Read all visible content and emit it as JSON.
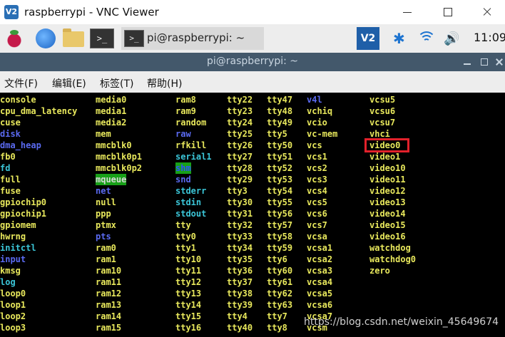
{
  "window": {
    "title": "raspberrypi - VNC Viewer",
    "logo_text": "V2"
  },
  "panel": {
    "terminal_icon_text": ">_",
    "task_label": "pi@raspberrypi: ~",
    "vnc_tray_text": "V2",
    "clock": "11:09"
  },
  "terminal": {
    "title": "pi@raspberrypi: ~",
    "menu": [
      "文件(F)",
      "编辑(E)",
      "标签(T)",
      "帮助(H)"
    ]
  },
  "columns": [
    [
      {
        "t": "console",
        "c": "y"
      },
      {
        "t": "cpu_dma_latency",
        "c": "y"
      },
      {
        "t": "cuse",
        "c": "y"
      },
      {
        "t": "disk",
        "c": "b"
      },
      {
        "t": "dma_heap",
        "c": "b"
      },
      {
        "t": "fb0",
        "c": "y"
      },
      {
        "t": "fd",
        "c": "c"
      },
      {
        "t": "full",
        "c": "y"
      },
      {
        "t": "fuse",
        "c": "y"
      },
      {
        "t": "gpiochip0",
        "c": "y"
      },
      {
        "t": "gpiochip1",
        "c": "y"
      },
      {
        "t": "gpiomem",
        "c": "y"
      },
      {
        "t": "hwrng",
        "c": "y"
      },
      {
        "t": "initctl",
        "c": "c"
      },
      {
        "t": "input",
        "c": "b"
      },
      {
        "t": "kmsg",
        "c": "y"
      },
      {
        "t": "log",
        "c": "c"
      },
      {
        "t": "loop0",
        "c": "y"
      },
      {
        "t": "loop1",
        "c": "y"
      },
      {
        "t": "loop2",
        "c": "y"
      },
      {
        "t": "loop3",
        "c": "y"
      }
    ],
    [
      {
        "t": "media0",
        "c": "y"
      },
      {
        "t": "media1",
        "c": "y"
      },
      {
        "t": "media2",
        "c": "y"
      },
      {
        "t": "mem",
        "c": "y"
      },
      {
        "t": "mmcblk0",
        "c": "y"
      },
      {
        "t": "mmcblk0p1",
        "c": "y"
      },
      {
        "t": "mmcblk0p2",
        "c": "y"
      },
      {
        "t": "mqueue",
        "c": "mq"
      },
      {
        "t": "net",
        "c": "b"
      },
      {
        "t": "null",
        "c": "y"
      },
      {
        "t": "ppp",
        "c": "y"
      },
      {
        "t": "ptmx",
        "c": "y"
      },
      {
        "t": "pts",
        "c": "b"
      },
      {
        "t": "ram0",
        "c": "y"
      },
      {
        "t": "ram1",
        "c": "y"
      },
      {
        "t": "ram10",
        "c": "y"
      },
      {
        "t": "ram11",
        "c": "y"
      },
      {
        "t": "ram12",
        "c": "y"
      },
      {
        "t": "ram13",
        "c": "y"
      },
      {
        "t": "ram14",
        "c": "y"
      },
      {
        "t": "ram15",
        "c": "y"
      }
    ],
    [
      {
        "t": "ram8",
        "c": "y"
      },
      {
        "t": "ram9",
        "c": "y"
      },
      {
        "t": "random",
        "c": "y"
      },
      {
        "t": "raw",
        "c": "b"
      },
      {
        "t": "rfkill",
        "c": "y"
      },
      {
        "t": "serial1",
        "c": "c"
      },
      {
        "t": "shm",
        "c": "shm"
      },
      {
        "t": "snd",
        "c": "b"
      },
      {
        "t": "stderr",
        "c": "c"
      },
      {
        "t": "stdin",
        "c": "c"
      },
      {
        "t": "stdout",
        "c": "c"
      },
      {
        "t": "tty",
        "c": "y"
      },
      {
        "t": "tty0",
        "c": "y"
      },
      {
        "t": "tty1",
        "c": "y"
      },
      {
        "t": "tty10",
        "c": "y"
      },
      {
        "t": "tty11",
        "c": "y"
      },
      {
        "t": "tty12",
        "c": "y"
      },
      {
        "t": "tty13",
        "c": "y"
      },
      {
        "t": "tty14",
        "c": "y"
      },
      {
        "t": "tty15",
        "c": "y"
      },
      {
        "t": "tty16",
        "c": "y"
      }
    ],
    [
      {
        "t": "tty22",
        "c": "y"
      },
      {
        "t": "tty23",
        "c": "y"
      },
      {
        "t": "tty24",
        "c": "y"
      },
      {
        "t": "tty25",
        "c": "y"
      },
      {
        "t": "tty26",
        "c": "y"
      },
      {
        "t": "tty27",
        "c": "y"
      },
      {
        "t": "tty28",
        "c": "y"
      },
      {
        "t": "tty29",
        "c": "y"
      },
      {
        "t": "tty3",
        "c": "y"
      },
      {
        "t": "tty30",
        "c": "y"
      },
      {
        "t": "tty31",
        "c": "y"
      },
      {
        "t": "tty32",
        "c": "y"
      },
      {
        "t": "tty33",
        "c": "y"
      },
      {
        "t": "tty34",
        "c": "y"
      },
      {
        "t": "tty35",
        "c": "y"
      },
      {
        "t": "tty36",
        "c": "y"
      },
      {
        "t": "tty37",
        "c": "y"
      },
      {
        "t": "tty38",
        "c": "y"
      },
      {
        "t": "tty39",
        "c": "y"
      },
      {
        "t": "tty4",
        "c": "y"
      },
      {
        "t": "tty40",
        "c": "y"
      }
    ],
    [
      {
        "t": "tty47",
        "c": "y"
      },
      {
        "t": "tty48",
        "c": "y"
      },
      {
        "t": "tty49",
        "c": "y"
      },
      {
        "t": "tty5",
        "c": "y"
      },
      {
        "t": "tty50",
        "c": "y"
      },
      {
        "t": "tty51",
        "c": "y"
      },
      {
        "t": "tty52",
        "c": "y"
      },
      {
        "t": "tty53",
        "c": "y"
      },
      {
        "t": "tty54",
        "c": "y"
      },
      {
        "t": "tty55",
        "c": "y"
      },
      {
        "t": "tty56",
        "c": "y"
      },
      {
        "t": "tty57",
        "c": "y"
      },
      {
        "t": "tty58",
        "c": "y"
      },
      {
        "t": "tty59",
        "c": "y"
      },
      {
        "t": "tty6",
        "c": "y"
      },
      {
        "t": "tty60",
        "c": "y"
      },
      {
        "t": "tty61",
        "c": "y"
      },
      {
        "t": "tty62",
        "c": "y"
      },
      {
        "t": "tty63",
        "c": "y"
      },
      {
        "t": "tty7",
        "c": "y"
      },
      {
        "t": "tty8",
        "c": "y"
      }
    ],
    [
      {
        "t": "v4l",
        "c": "b"
      },
      {
        "t": "vchiq",
        "c": "y"
      },
      {
        "t": "vcio",
        "c": "y"
      },
      {
        "t": "vc-mem",
        "c": "y"
      },
      {
        "t": "vcs",
        "c": "y"
      },
      {
        "t": "vcs1",
        "c": "y"
      },
      {
        "t": "vcs2",
        "c": "y"
      },
      {
        "t": "vcs3",
        "c": "y"
      },
      {
        "t": "vcs4",
        "c": "y"
      },
      {
        "t": "vcs5",
        "c": "y"
      },
      {
        "t": "vcs6",
        "c": "y"
      },
      {
        "t": "vcs7",
        "c": "y"
      },
      {
        "t": "vcsa",
        "c": "y"
      },
      {
        "t": "vcsa1",
        "c": "y"
      },
      {
        "t": "vcsa2",
        "c": "y"
      },
      {
        "t": "vcsa3",
        "c": "y"
      },
      {
        "t": "vcsa4",
        "c": "y"
      },
      {
        "t": "vcsa5",
        "c": "y"
      },
      {
        "t": "vcsa6",
        "c": "y"
      },
      {
        "t": "vcsa7",
        "c": "y"
      },
      {
        "t": "vcsm",
        "c": "y"
      }
    ],
    [
      {
        "t": "vcsu5",
        "c": "y"
      },
      {
        "t": "vcsu6",
        "c": "y"
      },
      {
        "t": "vcsu7",
        "c": "y"
      },
      {
        "t": "vhci",
        "c": "y"
      },
      {
        "t": "video0",
        "c": "y"
      },
      {
        "t": "video1",
        "c": "y"
      },
      {
        "t": "video10",
        "c": "y"
      },
      {
        "t": "video11",
        "c": "y"
      },
      {
        "t": "video12",
        "c": "y"
      },
      {
        "t": "video13",
        "c": "y"
      },
      {
        "t": "video14",
        "c": "y"
      },
      {
        "t": "video15",
        "c": "y"
      },
      {
        "t": "video16",
        "c": "y"
      },
      {
        "t": "watchdog",
        "c": "y"
      },
      {
        "t": "watchdog0",
        "c": "y"
      },
      {
        "t": "zero",
        "c": "y"
      }
    ]
  ],
  "watermark": "https://blog.csdn.net/weixin_45649674",
  "colors": {
    "yellow": "#e8e85c",
    "blue": "#5a6af0",
    "cyan": "#3bc6d8",
    "highlight_green": "#18a018",
    "callout_red": "#e2212b"
  }
}
